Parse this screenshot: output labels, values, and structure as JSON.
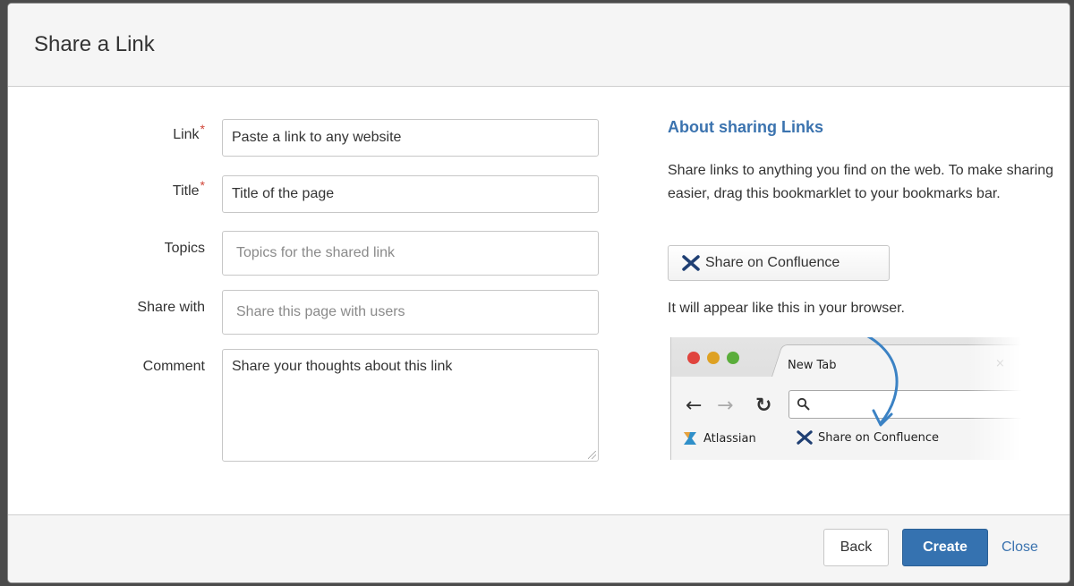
{
  "dialog": {
    "title": "Share a Link"
  },
  "form": {
    "link": {
      "label": "Link",
      "required_mark": "*",
      "value": "Paste a link to any website"
    },
    "title": {
      "label": "Title",
      "required_mark": "*",
      "value": "Title of the page"
    },
    "topics": {
      "label": "Topics",
      "placeholder": "Topics for the shared link"
    },
    "share_with": {
      "label": "Share with",
      "placeholder": "Share this page with users"
    },
    "comment": {
      "label": "Comment",
      "value": "Share your thoughts about this link"
    }
  },
  "sidebar": {
    "heading": "About sharing Links",
    "description": "Share links to anything you find on the web. To make sharing easier, drag this bookmarklet to your bookmarks bar.",
    "bookmarklet_label": "Share on Confluence",
    "appear_text": "It will appear like this in your browser.",
    "browser_preview": {
      "tab_title": "New Tab",
      "tab_close": "×",
      "bookmarks": [
        "Atlassian",
        "Share on Confluence"
      ]
    }
  },
  "footer": {
    "back_label": "Back",
    "create_label": "Create",
    "close_label": "Close"
  },
  "colors": {
    "accent": "#3572b0",
    "link": "#3b73af",
    "required": "#d04437"
  }
}
